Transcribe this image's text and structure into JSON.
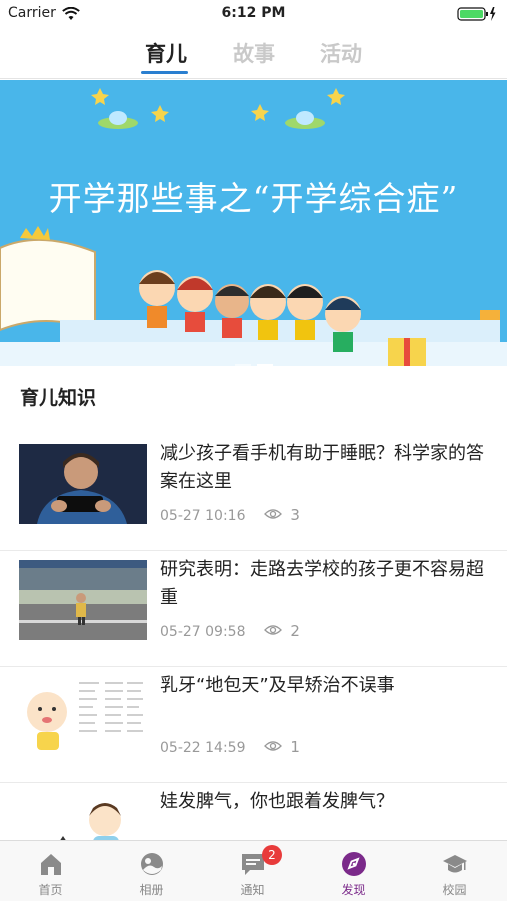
{
  "status": {
    "carrier": "Carrier",
    "time": "6:12 PM"
  },
  "tabs": [
    {
      "label": "育儿",
      "active": true
    },
    {
      "label": "故事",
      "active": false
    },
    {
      "label": "活动",
      "active": false
    }
  ],
  "banner": {
    "title": "开学那些事之“开学综合症”"
  },
  "section": {
    "title": "育儿知识"
  },
  "articles": [
    {
      "title": "减少孩子看手机有助于睡眠？科学家的答案在这里",
      "date": "05-27 10:16",
      "views": "3"
    },
    {
      "title": "研究表明：走路去学校的孩子更不容易超重",
      "date": "05-27 09:58",
      "views": "2"
    },
    {
      "title": "乳牙“地包天”及早矫治不误事",
      "date": "05-22 14:59",
      "views": "1"
    },
    {
      "title": "娃发脾气，你也跟着发脾气？"
    }
  ],
  "tabbar": {
    "items": [
      {
        "label": "首页",
        "icon": "home-icon"
      },
      {
        "label": "相册",
        "icon": "album-icon"
      },
      {
        "label": "通知",
        "icon": "notification-icon",
        "badge": "2"
      },
      {
        "label": "发现",
        "icon": "discover-icon",
        "active": true
      },
      {
        "label": "校园",
        "icon": "campus-icon"
      }
    ]
  },
  "colors": {
    "accent": "#2a7fd0",
    "active_tab": "#7b2a8a",
    "badge": "#e83b3b",
    "banner_bg": "#49b6ea"
  }
}
